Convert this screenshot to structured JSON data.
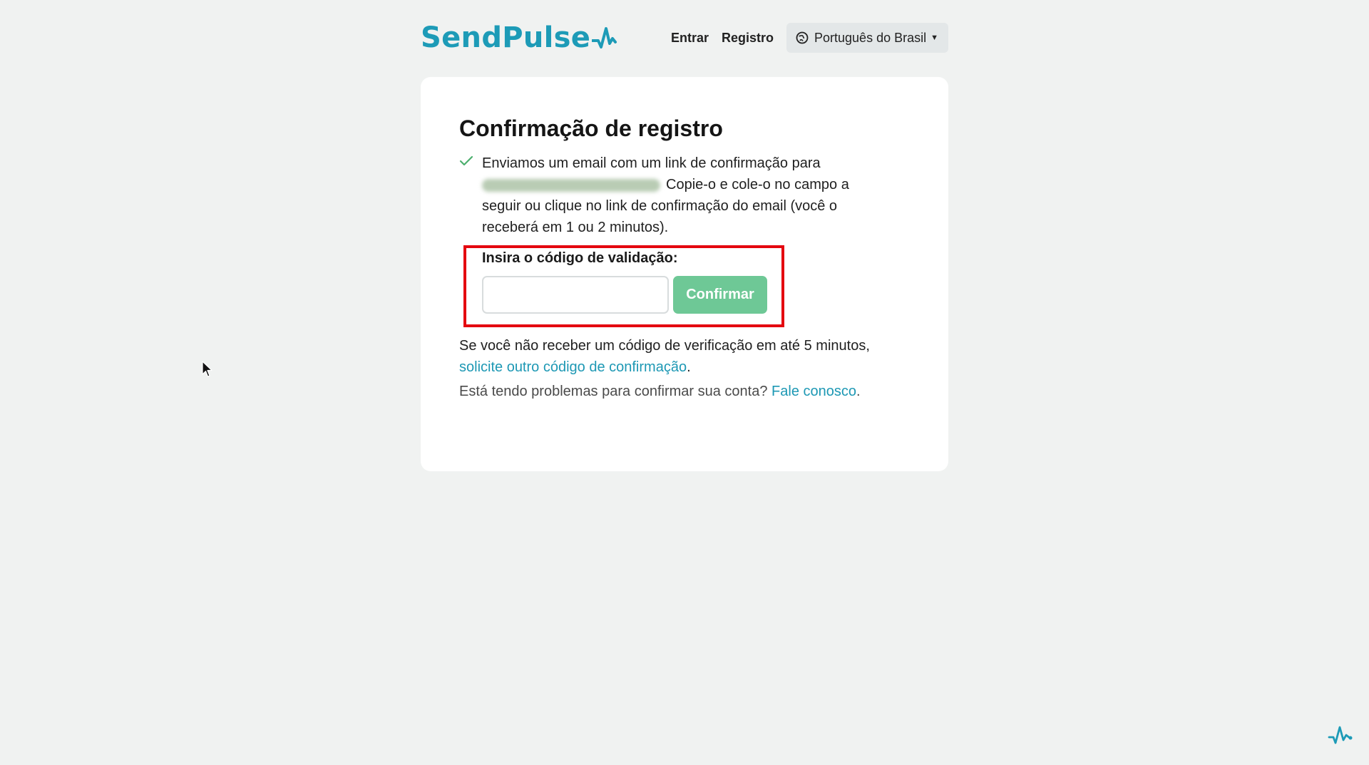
{
  "header": {
    "logo_text": "SendPulse",
    "nav": {
      "login": "Entrar",
      "register": "Registro"
    },
    "language": {
      "label": "Português do Brasil",
      "icon": "globe-icon"
    }
  },
  "card": {
    "title": "Confirmação de registro",
    "message_part1": "Enviamos um email com um link de confirmação para",
    "message_part2": "Copie-o e cole-o no campo a seguir ou clique no link de confirmação do email (você o receberá em 1 ou 2 minutos).",
    "code_label": "Insira o código de validação:",
    "code_input": {
      "value": "",
      "placeholder": ""
    },
    "confirm_button": "Confirmar",
    "resend_text": "Se você não receber um código de verificação em até 5 minutos,",
    "resend_link": "solicite outro código de confirmação",
    "resend_end": ".",
    "problem_text": "Está tendo problemas para confirmar sua conta?",
    "contact_link": "Fale conosco",
    "problem_end": "."
  },
  "colors": {
    "brand": "#1d9bb7",
    "confirm_button": "#6ec896",
    "highlight_border": "#e4050f",
    "check": "#4caf6e"
  }
}
